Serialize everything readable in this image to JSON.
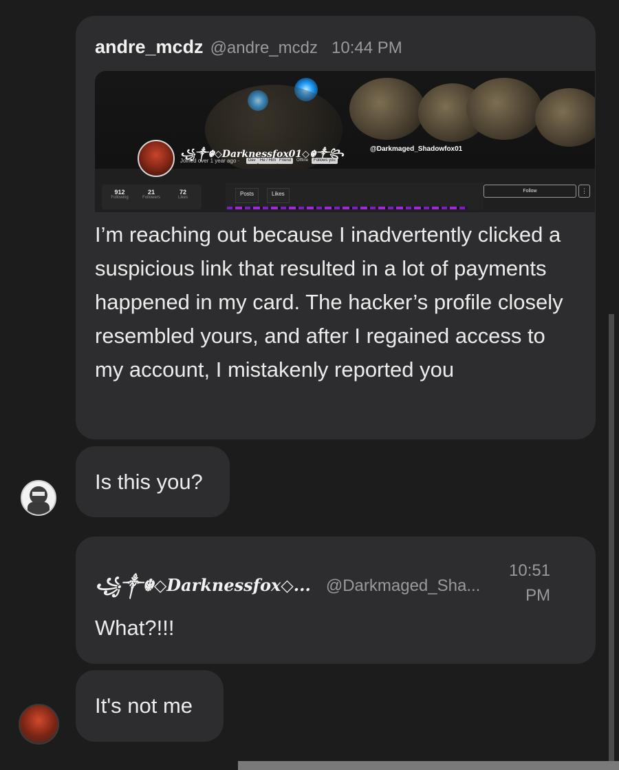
{
  "messages": [
    {
      "author": "andre_mcdz",
      "handle": "@andre_mcdz",
      "time": "10:44 PM",
      "text": "I’m reaching out because I inadvertently clicked a suspicious link that resulted in a lot of payments happened in my card. The hacker’s profile closely resembled yours, and after I regained access to my account, I mistakenly reported you",
      "attachment": {
        "profile_name": "꧁༒☬◇Darknessfox01◇☬༒꧂",
        "profile_handle": "@Darkmaged_Shadowfox01",
        "joined": "Joined over 1 year ago ·",
        "tags": [
          "Dev",
          "He / Him",
          "Friend",
          "Offline",
          "Follows you"
        ],
        "stats": [
          {
            "num": "912",
            "label": "Following"
          },
          {
            "num": "21",
            "label": "Followers"
          },
          {
            "num": "72",
            "label": "Likes"
          }
        ],
        "tabs": [
          "Posts",
          "Likes"
        ],
        "follow_label": "Follow",
        "more_label": "⋮"
      }
    },
    {
      "text": "Is this you?"
    },
    {
      "author": "꧁༒☬◇Darknessfox◇...",
      "handle": "@Darkmaged_Sha...",
      "time_line1": "10:51",
      "time_line2": "PM",
      "text": "What?!!!"
    },
    {
      "text": "It's not me"
    }
  ],
  "avatars": {
    "user": "hooded-user-avatar",
    "fox": "fox-avatar"
  },
  "colors": {
    "background": "#1c1c1d",
    "bubble": "#2d2d2f",
    "text": "#ececec",
    "muted": "#9a9a9c"
  }
}
